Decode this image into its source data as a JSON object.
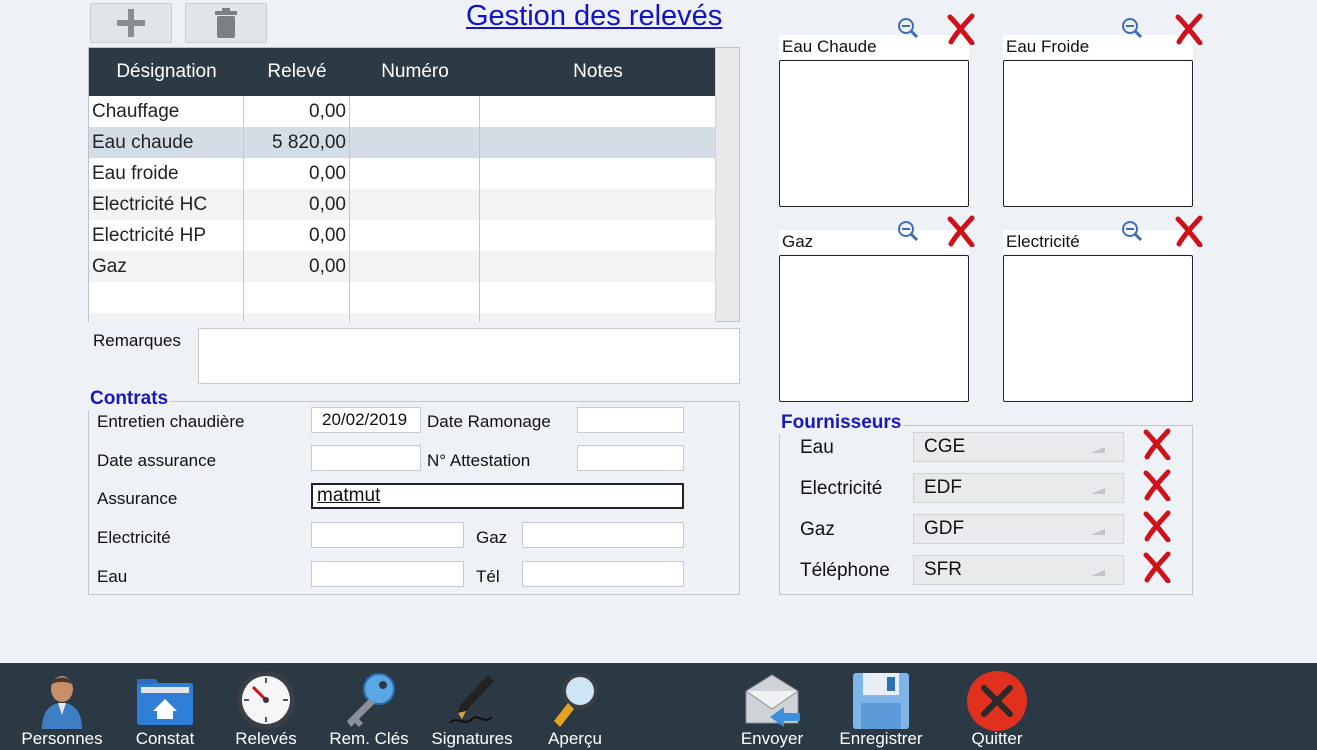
{
  "title": "Gestion des relevés",
  "grid": {
    "columns": [
      "Désignation",
      "Relevé",
      "Numéro",
      "Notes"
    ],
    "rows": [
      {
        "designation": "Chauffage",
        "releve": "0,00",
        "numero": "",
        "notes": ""
      },
      {
        "designation": "Eau chaude",
        "releve": "5 820,00",
        "numero": "",
        "notes": ""
      },
      {
        "designation": "Eau froide",
        "releve": "0,00",
        "numero": "",
        "notes": ""
      },
      {
        "designation": "Electricité HC",
        "releve": "0,00",
        "numero": "",
        "notes": ""
      },
      {
        "designation": "Electricité HP",
        "releve": "0,00",
        "numero": "",
        "notes": ""
      },
      {
        "designation": "Gaz",
        "releve": "0,00",
        "numero": "",
        "notes": ""
      }
    ]
  },
  "remarques": {
    "label": "Remarques",
    "value": ""
  },
  "contrats": {
    "title": "Contrats",
    "entretien_label": "Entretien chaudière",
    "entretien_value": "20/02/2019",
    "ramonage_label": "Date Ramonage",
    "ramonage_value": "",
    "assurance_date_label": "Date assurance",
    "assurance_date_value": "",
    "attestation_label": "N° Attestation",
    "attestation_value": "",
    "assurance_label": "Assurance",
    "assurance_value": "matmut",
    "electricite_label": "Electricité",
    "electricite_value": "",
    "gaz_label": "Gaz",
    "gaz_value": "",
    "eau_label": "Eau",
    "eau_value": "",
    "tel_label": "Tél",
    "tel_value": ""
  },
  "photos": [
    {
      "label": "Eau Chaude"
    },
    {
      "label": "Eau Froide"
    },
    {
      "label": "Gaz"
    },
    {
      "label": "Electricité"
    }
  ],
  "fournisseurs": {
    "title": "Fournisseurs",
    "items": [
      {
        "label": "Eau",
        "value": "CGE"
      },
      {
        "label": "Electricité",
        "value": "EDF"
      },
      {
        "label": "Gaz",
        "value": "GDF"
      },
      {
        "label": "Téléphone",
        "value": "SFR"
      }
    ]
  },
  "bottombar": {
    "personnes": "Personnes",
    "constat": "Constat",
    "releves": "Relevés",
    "rem_cles": "Rem. Clés",
    "signatures": "Signatures",
    "apercu": "Aperçu",
    "envoyer": "Envoyer",
    "enregistrer": "Enregistrer",
    "quitter": "Quitter"
  },
  "colors": {
    "accent": "#1212c8",
    "header": "#2c3a46",
    "delete": "#d0111a",
    "quit": "#e0301e"
  }
}
